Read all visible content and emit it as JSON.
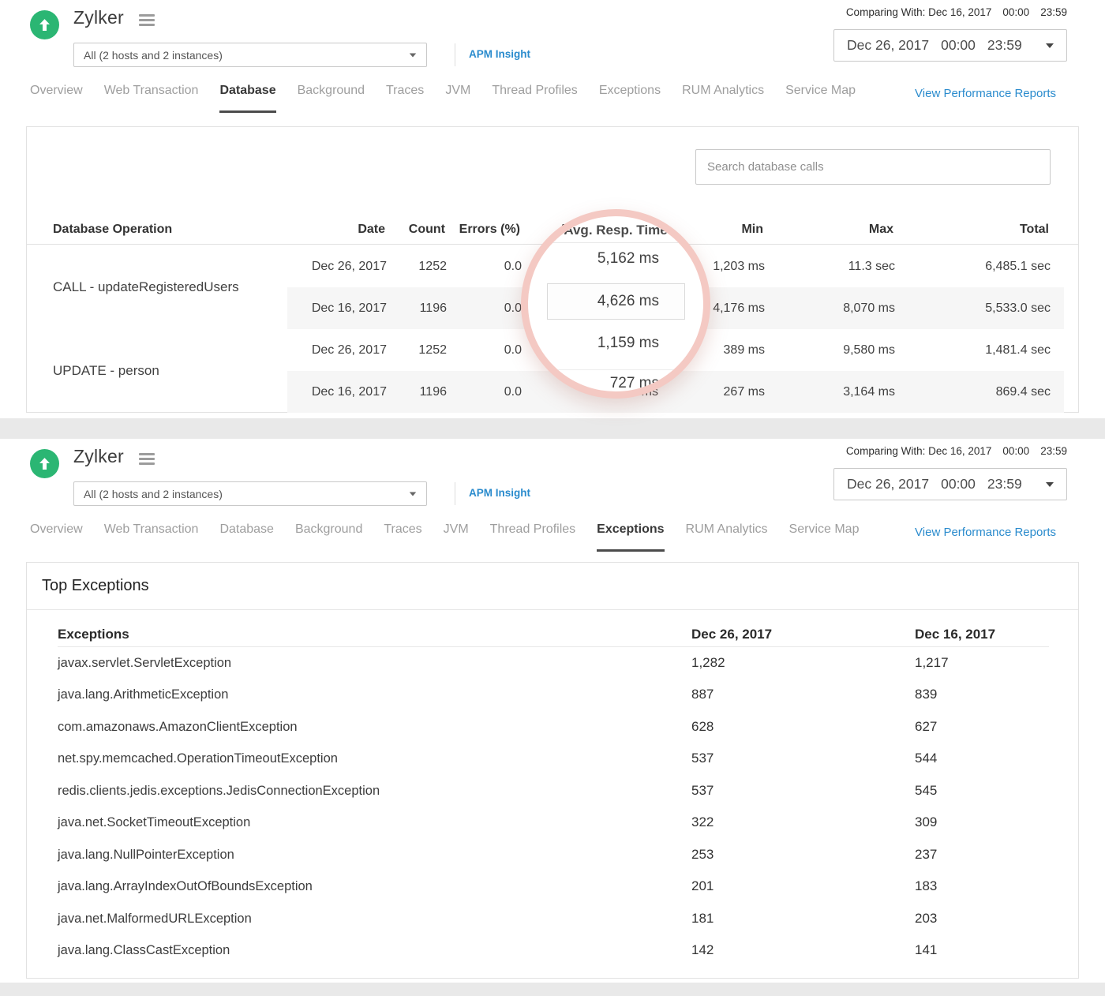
{
  "app": {
    "name": "Zylker",
    "host_selector": "All (2 hosts and 2 instances)",
    "apm_insight_link": "APM Insight",
    "view_reports_link": "View Performance Reports",
    "comparing_label": "Comparing With: Dec 16, 2017",
    "comparing_start": "00:00",
    "comparing_end": "23:59",
    "range_date": "Dec 26, 2017",
    "range_start": "00:00",
    "range_end": "23:59"
  },
  "tabs": [
    "Overview",
    "Web Transaction",
    "Database",
    "Background",
    "Traces",
    "JVM",
    "Thread Profiles",
    "Exceptions",
    "RUM Analytics",
    "Service Map"
  ],
  "database": {
    "search_placeholder": "Search database calls",
    "columns": [
      "Database Operation",
      "Date",
      "Count",
      "Errors (%)",
      "Avg. Resp. Time",
      "Min",
      "Max",
      "Total"
    ],
    "groups": [
      {
        "operation": "CALL - updateRegisteredUsers",
        "rows": [
          {
            "date": "Dec 26, 2017",
            "count": "1252",
            "errors": "0.0",
            "avg": "5,162 ms",
            "min": "1,203 ms",
            "max": "11.3 sec",
            "total": "6,485.1 sec"
          },
          {
            "date": "Dec 16, 2017",
            "count": "1196",
            "errors": "0.0",
            "avg": "4,626 ms",
            "min": "4,176 ms",
            "max": "8,070 ms",
            "total": "5,533.0 sec"
          }
        ]
      },
      {
        "operation": "UPDATE - person",
        "rows": [
          {
            "date": "Dec 26, 2017",
            "count": "1252",
            "errors": "0.0",
            "avg": "1,159 ms",
            "min": "389 ms",
            "max": "9,580 ms",
            "total": "1,481.4 sec"
          },
          {
            "date": "Dec 16, 2017",
            "count": "1196",
            "errors": "0.0",
            "avg": "727 ms",
            "min": "267 ms",
            "max": "3,164 ms",
            "total": "869.4 sec"
          }
        ]
      }
    ]
  },
  "magnifier": {
    "header": "Avg. Resp. Time",
    "values": [
      "5,162 ms",
      "4,626 ms",
      "1,159 ms",
      "727 ms"
    ]
  },
  "exceptions": {
    "title": "Top Exceptions",
    "columns": [
      "Exceptions",
      "Dec 26, 2017",
      "Dec 16, 2017"
    ],
    "rows": [
      [
        "javax.servlet.ServletException",
        "1,282",
        "1,217"
      ],
      [
        "java.lang.ArithmeticException",
        "887",
        "839"
      ],
      [
        "com.amazonaws.AmazonClientException",
        "628",
        "627"
      ],
      [
        "net.spy.memcached.OperationTimeoutException",
        "537",
        "544"
      ],
      [
        "redis.clients.jedis.exceptions.JedisConnectionException",
        "537",
        "545"
      ],
      [
        "java.net.SocketTimeoutException",
        "322",
        "309"
      ],
      [
        "java.lang.NullPointerException",
        "253",
        "237"
      ],
      [
        "java.lang.ArrayIndexOutOfBoundsException",
        "201",
        "183"
      ],
      [
        "java.net.MalformedURLException",
        "181",
        "203"
      ],
      [
        "java.lang.ClassCastException",
        "142",
        "141"
      ]
    ]
  },
  "colors": {
    "accent_green": "#2bb673",
    "link_blue": "#2a8bcd",
    "magnifier_ring": "#f4c9c3",
    "stripe_bg": "#f6f6f6"
  }
}
